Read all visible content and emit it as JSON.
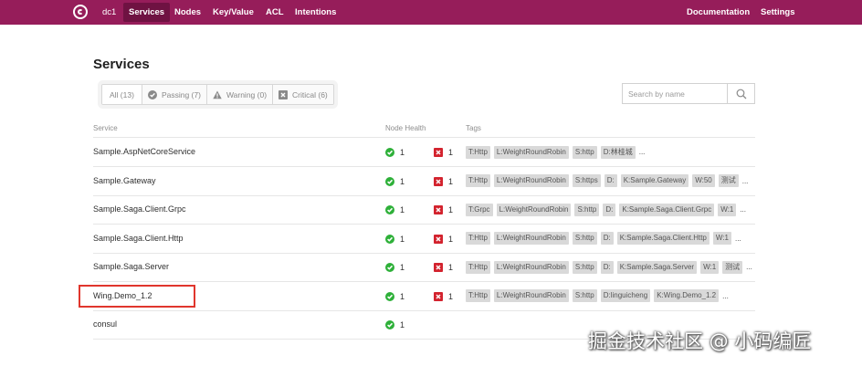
{
  "nav": {
    "datacenter": "dc1",
    "items": [
      "Services",
      "Nodes",
      "Key/Value",
      "ACL",
      "Intentions"
    ],
    "right_items": [
      "Documentation",
      "Settings"
    ],
    "brand_color": "#961d5a",
    "active_color": "#6f1242"
  },
  "page": {
    "title": "Services"
  },
  "filters": [
    {
      "label": "All (13)",
      "icon": ""
    },
    {
      "label": "Passing (7)",
      "icon": "check-circle-icon"
    },
    {
      "label": "Warning (0)",
      "icon": "warning-triangle-icon"
    },
    {
      "label": "Critical (6)",
      "icon": "critical-x-icon"
    }
  ],
  "search": {
    "placeholder": "Search by name",
    "value": ""
  },
  "table": {
    "headers": {
      "service": "Service",
      "health": "Node Health",
      "tags": "Tags"
    },
    "rows": [
      {
        "name": "Sample.AspNetCoreService",
        "passing": "1",
        "critical": "1",
        "tags": [
          "T:Http",
          "L:WeightRoundRobin",
          "S:http",
          "D:林桂城"
        ],
        "more": "..."
      },
      {
        "name": "Sample.Gateway",
        "passing": "1",
        "critical": "1",
        "tags": [
          "T:Http",
          "L:WeightRoundRobin",
          "S:https",
          "D:",
          "K:Sample.Gateway",
          "W:50",
          "测试"
        ],
        "more": "..."
      },
      {
        "name": "Sample.Saga.Client.Grpc",
        "passing": "1",
        "critical": "1",
        "tags": [
          "T:Grpc",
          "L:WeightRoundRobin",
          "S:http",
          "D:",
          "K:Sample.Saga.Client.Grpc",
          "W:1"
        ],
        "more": "..."
      },
      {
        "name": "Sample.Saga.Client.Http",
        "passing": "1",
        "critical": "1",
        "tags": [
          "T:Http",
          "L:WeightRoundRobin",
          "S:http",
          "D:",
          "K:Sample.Saga.Client.Http",
          "W:1"
        ],
        "more": "..."
      },
      {
        "name": "Sample.Saga.Server",
        "passing": "1",
        "critical": "1",
        "tags": [
          "T:Http",
          "L:WeightRoundRobin",
          "S:http",
          "D:",
          "K:Sample.Saga.Server",
          "W:1",
          "测试"
        ],
        "more": "..."
      },
      {
        "name": "Wing.Demo_1.2",
        "passing": "1",
        "critical": "1",
        "tags": [
          "T:Http",
          "L:WeightRoundRobin",
          "S:http",
          "D:linguicheng",
          "K:Wing.Demo_1.2"
        ],
        "more": "..."
      },
      {
        "name": "consul",
        "passing": "1",
        "critical": "",
        "tags": [],
        "more": ""
      }
    ]
  },
  "watermark": "掘金技术社区 @ 小码编匠",
  "colors": {
    "passing": "#2eb039",
    "critical": "#d3232e",
    "highlight_box": "#e0362d"
  }
}
